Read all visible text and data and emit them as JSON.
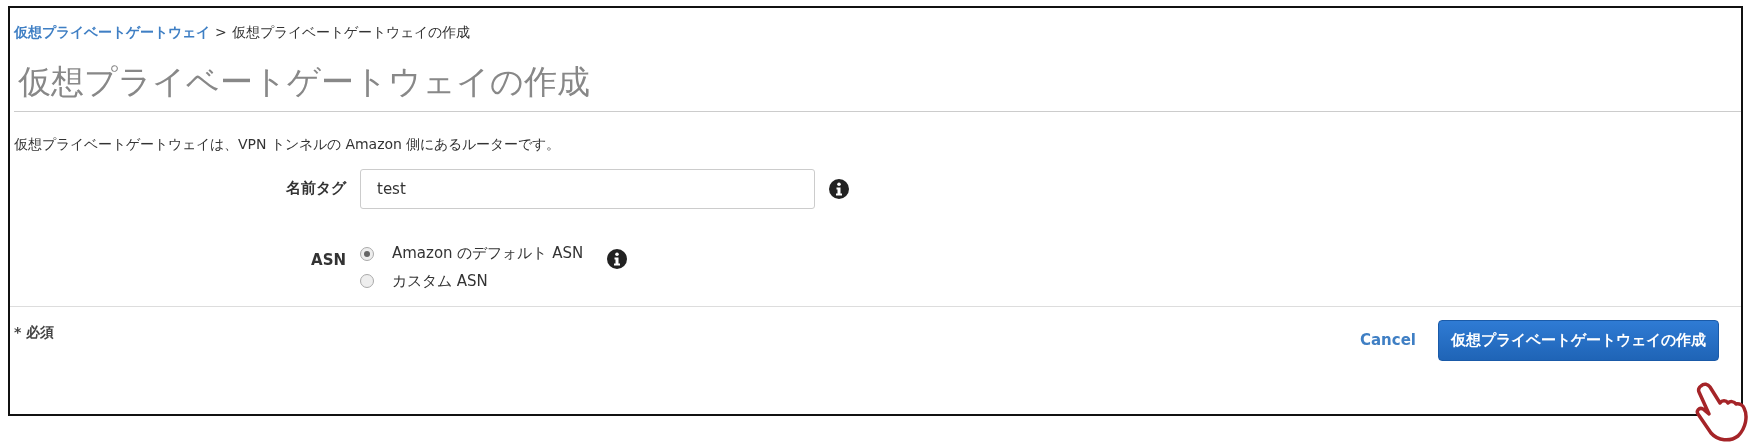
{
  "breadcrumb": {
    "link": "仮想プライベートゲートウェイ",
    "separator": ">",
    "current": "仮想プライベートゲートウェイの作成"
  },
  "title": "仮想プライベートゲートウェイの作成",
  "description": "仮想プライベートゲートウェイは、VPN トンネルの Amazon 側にあるルーターです。",
  "fields": [
    {
      "label": "名前タグ",
      "kind": "text",
      "value": "test"
    },
    {
      "label": "ASN",
      "kind": "radio",
      "options": [
        {
          "label": "Amazon のデフォルト ASN",
          "selected": true
        },
        {
          "label": "カスタム ASN",
          "selected": false
        }
      ]
    }
  ],
  "footer": {
    "required_note": "* 必須",
    "buttons": [
      {
        "label": "Cancel",
        "kind": "link"
      },
      {
        "label": "仮想プライベートゲートウェイの作成",
        "kind": "primary"
      }
    ]
  }
}
